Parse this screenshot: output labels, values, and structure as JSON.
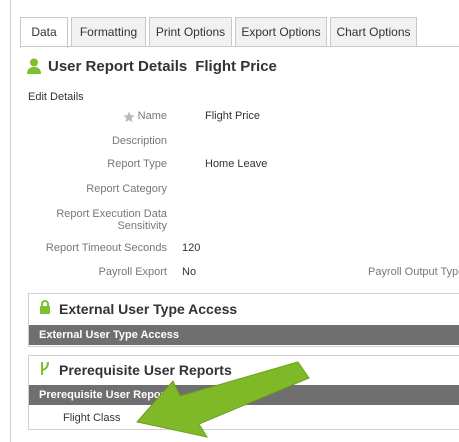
{
  "tabs": [
    {
      "label": "Data",
      "active": true
    },
    {
      "label": "Formatting",
      "active": false
    },
    {
      "label": "Print Options",
      "active": false
    },
    {
      "label": "Export Options",
      "active": false
    },
    {
      "label": "Chart Options",
      "active": false
    }
  ],
  "header": {
    "title": "User Report Details",
    "subtitle": "Flight Price",
    "icon": "user-icon"
  },
  "edit_details": "Edit Details",
  "fields": {
    "name": {
      "label": "Name",
      "value": "Flight Price"
    },
    "description": {
      "label": "Description",
      "value": ""
    },
    "report_type": {
      "label": "Report Type",
      "value": "Home Leave"
    },
    "report_category": {
      "label": "Report Category",
      "value": ""
    },
    "exec_sensitivity": {
      "label_line1": "Report Execution Data",
      "label_line2": "Sensitivity",
      "value": ""
    },
    "timeout": {
      "label": "Report Timeout Seconds",
      "value": "120"
    },
    "payroll_export": {
      "label": "Payroll Export",
      "value": "No"
    },
    "payroll_output": {
      "label": "Payroll Output Type"
    }
  },
  "external_access": {
    "title": "External User Type Access",
    "bar_label": "External User Type Access"
  },
  "prerequisite": {
    "title": "Prerequisite User Reports",
    "bar_label": "Prerequisite User Report",
    "rows": [
      "Flight Class"
    ]
  },
  "colors": {
    "accent_green": "#7cbf2f",
    "arrow_green": "#7fb927",
    "bar_gray": "#6f6f6f"
  }
}
